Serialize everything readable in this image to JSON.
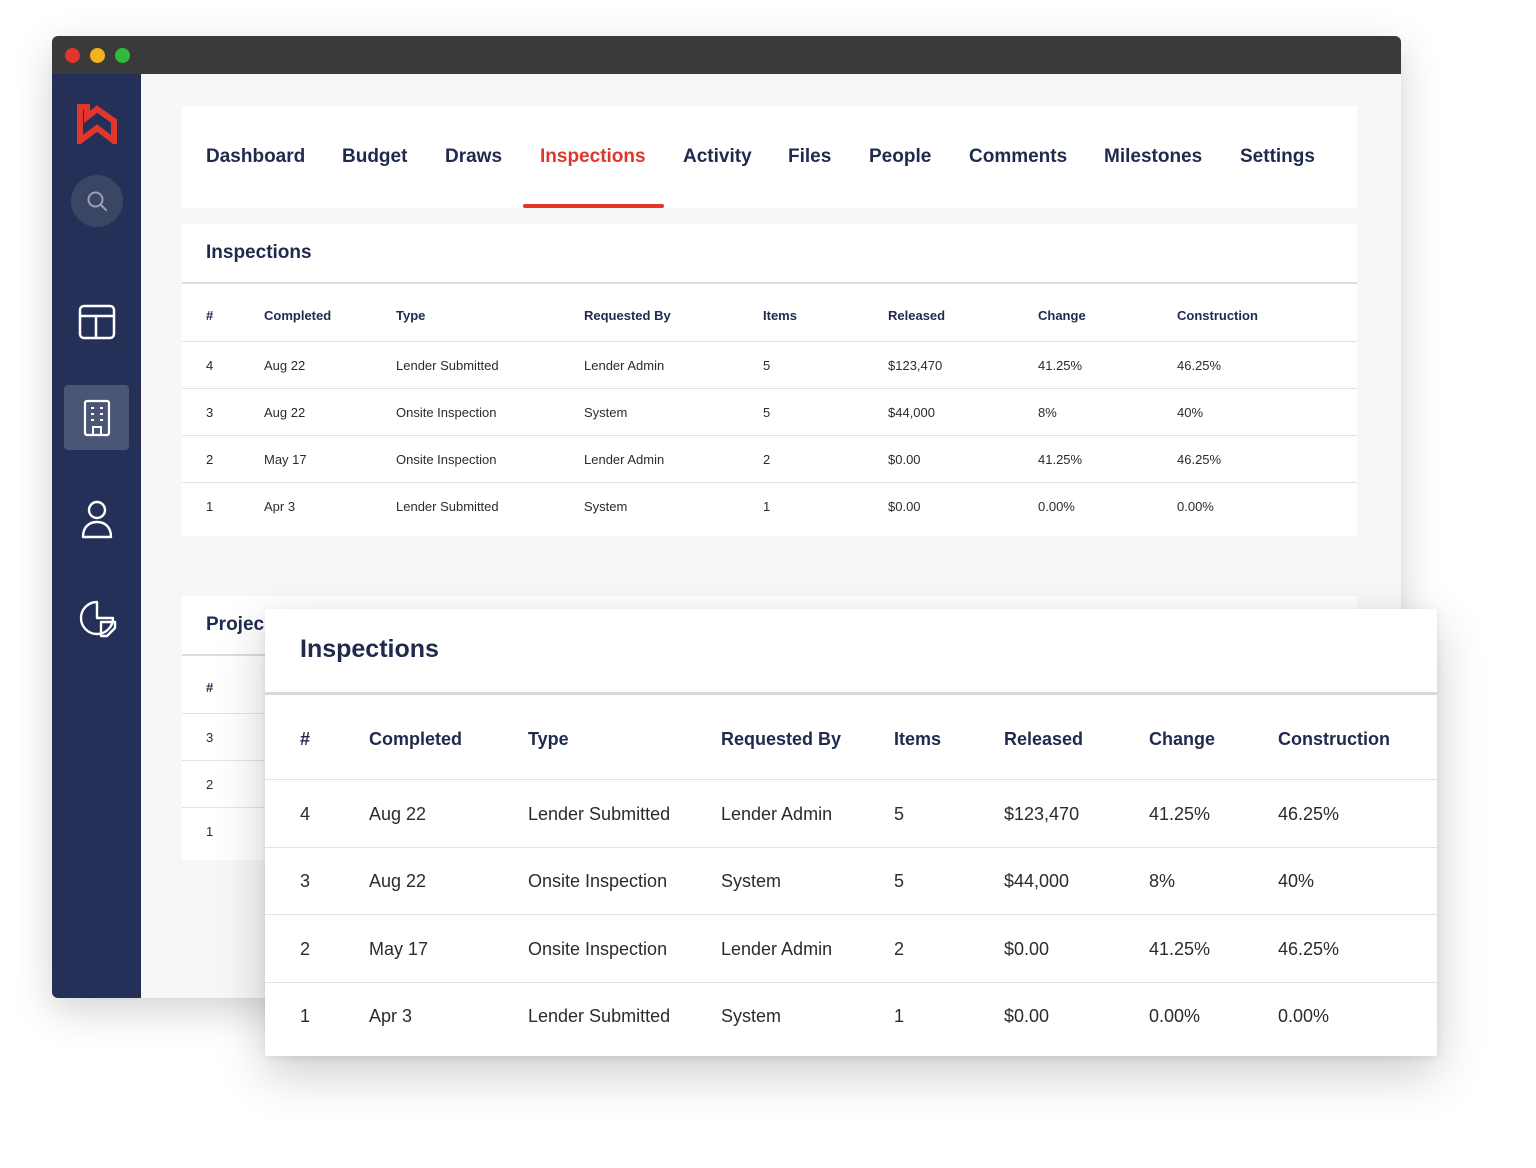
{
  "nav": {
    "items": [
      {
        "label": "Dashboard"
      },
      {
        "label": "Budget"
      },
      {
        "label": "Draws"
      },
      {
        "label": "Inspections"
      },
      {
        "label": "Activity"
      },
      {
        "label": "Files"
      },
      {
        "label": "People"
      },
      {
        "label": "Comments"
      },
      {
        "label": "Milestones"
      },
      {
        "label": "Settings"
      }
    ],
    "active": "Inspections"
  },
  "sidebar": {
    "icons": [
      "logo-icon",
      "search-icon",
      "layout-icon",
      "building-icon",
      "user-icon",
      "chart-icon"
    ],
    "active": "building-icon"
  },
  "inspections": {
    "title": "Inspections",
    "columns": [
      "#",
      "Completed",
      "Type",
      "Requested By",
      "Items",
      "Released",
      "Change",
      "Construction"
    ],
    "rows": [
      [
        "4",
        "Aug 22",
        "Lender Submitted",
        "Lender Admin",
        "5",
        "$123,470",
        "41.25%",
        "46.25%"
      ],
      [
        "3",
        "Aug 22",
        "Onsite Inspection",
        "System",
        "5",
        "$44,000",
        "8%",
        "40%"
      ],
      [
        "2",
        "May 17",
        "Onsite Inspection",
        "Lender Admin",
        "2",
        "$0.00",
        "41.25%",
        "46.25%"
      ],
      [
        "1",
        "Apr 3",
        "Lender Submitted",
        "System",
        "1",
        "$0.00",
        "0.00%",
        "0.00%"
      ]
    ]
  },
  "projects_card": {
    "title": "Projec",
    "header_first": "#",
    "rows": [
      "3",
      "2",
      "1"
    ]
  },
  "colors": {
    "accent": "#e0362c",
    "navy": "#243057",
    "text": "#1f2a4d"
  }
}
